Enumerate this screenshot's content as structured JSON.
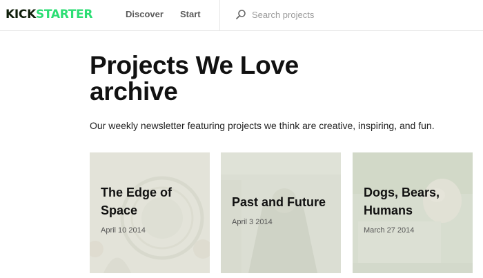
{
  "header": {
    "logo": {
      "part1": "KICK",
      "part2": "STARTER"
    },
    "nav": [
      {
        "label": "Discover"
      },
      {
        "label": "Start"
      }
    ],
    "search": {
      "placeholder": "Search projects",
      "icon": "search-icon"
    }
  },
  "main": {
    "title": "Projects We Love archive",
    "subtitle": "Our weekly newsletter featuring projects we think are creative, inspiring, and fun."
  },
  "cards": [
    {
      "title": "The Edge of Space",
      "date": "April 10 2014"
    },
    {
      "title": "Past and Future",
      "date": "April 3 2014"
    },
    {
      "title": "Dogs, Bears, Humans",
      "date": "March 27 2014"
    }
  ],
  "colors": {
    "brand_dark": "#0f1e0a",
    "brand_green": "#2bde73",
    "nav_text": "#5a5a5a",
    "placeholder": "#9a9a9a"
  }
}
